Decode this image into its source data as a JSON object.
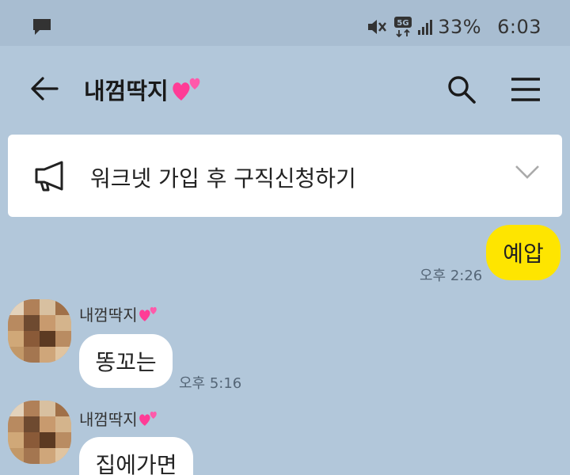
{
  "status_bar": {
    "battery": "33%",
    "time": "6:03",
    "network": "5G"
  },
  "header": {
    "title": "내껌딱지"
  },
  "notice": {
    "text": "워크넷 가입 후 구직신청하기"
  },
  "messages": [
    {
      "from": "me",
      "text": "예압",
      "time": "오후 2:26"
    },
    {
      "from": "friend",
      "sender": "내껌딱지",
      "text": "똥꼬는",
      "time": "오후 5:16"
    },
    {
      "from": "friend",
      "sender": "내껌딱지",
      "text": "집에가면",
      "time": ""
    }
  ],
  "colors": {
    "background": "#b2c7da",
    "status_bar": "#a8bdd1",
    "my_bubble": "#fee500",
    "friend_bubble": "#ffffff"
  }
}
